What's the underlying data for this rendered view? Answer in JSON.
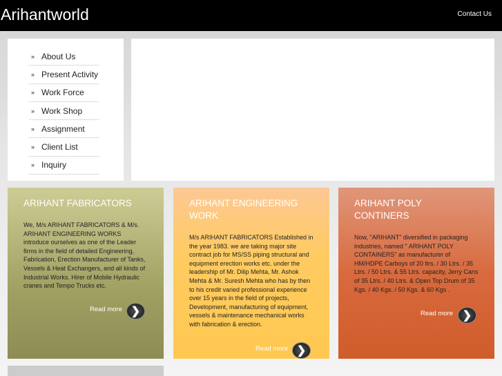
{
  "header": {
    "logo": "Arihantworld",
    "contact": "Contact Us"
  },
  "nav": {
    "bullet": "»",
    "items": [
      "About Us",
      "Present Activity",
      "Work Force",
      "Work Shop",
      "Assignment",
      "Client List",
      "Inquiry"
    ]
  },
  "cards": [
    {
      "title": "ARIHANT FABRICATORS",
      "body": "We, M/s ARIHANT FABRICATORS & M/s. ARIHANT ENGINEERING WORKS introduce ourselves as one of the Leader firms in the field of detailed Engineering, Fabrication, Erection Manufacturer of Tanks, Vessels & Heat Exchangers, and all kinds of Industrial Works. Hirer of Mobile Hydraulic cranes and Tempo Trucks etc.",
      "more": "Read more"
    },
    {
      "title": "ARIHANT ENGINEERING WORK",
      "body": "M/s ARIHANT FABRICATORS Established in the year 1983. we are taking major site contract job for MS/SS piping structural and equipment erection works etc. under the leadership of Mr. Dilip Mehta, Mr. Ashok Mehta & Mr. Suresh Mehta who has by then to his credit varied professional experience over 15 years in the field of projects, Development, manufacturing of equipment, vessels & maintenance mechanical works with fabrication & erection.",
      "more": "Read more"
    },
    {
      "title": "ARIHANT POLY CONTINERS",
      "body": "Now, \"ARIHANT\" diversified in packaging industries, named \" ARIHANT POLY CONTAINERS\" as manufacturer of HM/HDPE Carboys of 20 ltrs. / 30 Ltrs. / 35 Ltrs. / 50 Ltrs. & 55 Ltrs. capacity, Jerry Cans of 35 Ltrs. / 40 Ltrs. & Open Top Drum of 35 Kgs. / 40 Kgs. / 50 Kgs. & 60 Kgs .",
      "more": "Read more"
    }
  ],
  "arrow_glyph": "❯"
}
